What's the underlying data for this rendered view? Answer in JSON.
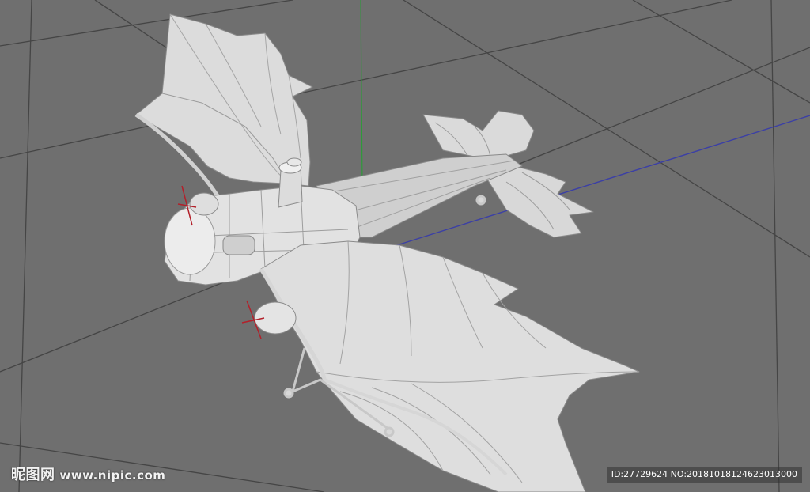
{
  "watermark": {
    "logo_text": "昵图网",
    "site": "www.nipic.com"
  },
  "id_line": "ID:27729624 NO:20181018124623013000",
  "viewport": {
    "background": "#6f6f6f",
    "grid_color": "#454545",
    "axis_x_color": "#3b3fa6",
    "axis_y_color": "#2e9a3a",
    "model_color": "#e6e6e6",
    "edge_color": "#8a8a8a",
    "prop_color": "#b3202a"
  }
}
